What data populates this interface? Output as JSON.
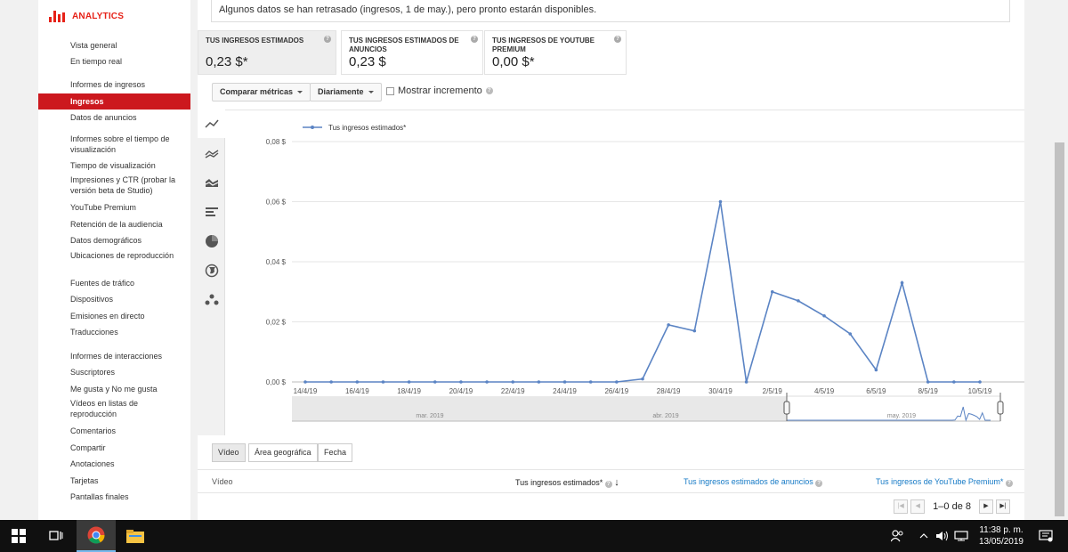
{
  "brand": {
    "label": "ANALYTICS",
    "color": "#e62117"
  },
  "sidebar": {
    "items": [
      {
        "label": "Vista general",
        "type": "link"
      },
      {
        "label": "En tiempo real",
        "type": "link"
      },
      {
        "label": "Informes de ingresos",
        "type": "section"
      },
      {
        "label": "Ingresos",
        "type": "link",
        "active": true
      },
      {
        "label": "Datos de anuncios",
        "type": "link"
      },
      {
        "label": "Informes sobre el tiempo de visualización",
        "type": "section"
      },
      {
        "label": "Tiempo de visualización",
        "type": "link"
      },
      {
        "label": "Impresiones y CTR (probar la versión beta de Studio)",
        "type": "link"
      },
      {
        "label": "YouTube Premium",
        "type": "link"
      },
      {
        "label": "Retención de la audiencia",
        "type": "link"
      },
      {
        "label": "Datos demográficos",
        "type": "link"
      },
      {
        "label": "Ubicaciones de reproducción",
        "type": "link"
      },
      {
        "label": "Fuentes de tráfico",
        "type": "link"
      },
      {
        "label": "Dispositivos",
        "type": "link"
      },
      {
        "label": "Emisiones en directo",
        "type": "link"
      },
      {
        "label": "Traducciones",
        "type": "link"
      },
      {
        "label": "Informes de interacciones",
        "type": "section"
      },
      {
        "label": "Suscriptores",
        "type": "link"
      },
      {
        "label": "Me gusta y No me gusta",
        "type": "link"
      },
      {
        "label": "Vídeos en listas de reproducción",
        "type": "link"
      },
      {
        "label": "Comentarios",
        "type": "link"
      },
      {
        "label": "Compartir",
        "type": "link"
      },
      {
        "label": "Anotaciones",
        "type": "link"
      },
      {
        "label": "Tarjetas",
        "type": "link"
      },
      {
        "label": "Pantallas finales",
        "type": "link"
      }
    ]
  },
  "notice": "Algunos datos se han retrasado (ingresos, 1 de may.), pero pronto estarán disponibles.",
  "kpis": [
    {
      "title": "TUS INGRESOS ESTIMADOS",
      "value": "0,23 $*",
      "selected": true
    },
    {
      "title": "TUS INGRESOS ESTIMADOS DE ANUNCIOS",
      "value": "0,23 $"
    },
    {
      "title": "TUS INGRESOS DE YOUTUBE PREMIUM",
      "value": "0,00 $*"
    }
  ],
  "controls": {
    "compare_label": "Comparar métricas",
    "period_label": "Diariamente",
    "increment_label": "Mostrar incremento"
  },
  "chart_tools": [
    "line-chart-icon",
    "multi-line-icon",
    "stacked-area-icon",
    "bar-chart-icon",
    "pie-chart-icon",
    "globe-icon",
    "bubble-chart-icon"
  ],
  "chart_data": {
    "type": "line",
    "legend": "Tus ingresos estimados*",
    "legend_position": "top-left",
    "grid": true,
    "x": [
      "14/4/19",
      "15/4/19",
      "16/4/19",
      "17/4/19",
      "18/4/19",
      "19/4/19",
      "20/4/19",
      "21/4/19",
      "22/4/19",
      "23/4/19",
      "24/4/19",
      "25/4/19",
      "26/4/19",
      "27/4/19",
      "28/4/19",
      "29/4/19",
      "30/4/19",
      "1/5/19",
      "2/5/19",
      "3/5/19",
      "4/5/19",
      "5/5/19",
      "6/5/19",
      "7/5/19",
      "8/5/19",
      "9/5/19",
      "10/5/19"
    ],
    "series": [
      {
        "name": "Tus ingresos estimados*",
        "color": "#5b84c4",
        "values": [
          0,
          0,
          0,
          0,
          0,
          0,
          0,
          0,
          0,
          0,
          0,
          0,
          0,
          0.001,
          0.019,
          0.017,
          0.06,
          0,
          0.03,
          0.027,
          0.022,
          0.016,
          0.004,
          0.033,
          0,
          0,
          0
        ]
      }
    ],
    "x_tick_labels": [
      "14/4/19",
      "16/4/19",
      "18/4/19",
      "20/4/19",
      "22/4/19",
      "24/4/19",
      "26/4/19",
      "28/4/19",
      "30/4/19",
      "2/5/19",
      "4/5/19",
      "6/5/19",
      "8/5/19",
      "10/5/19"
    ],
    "y_ticks": [
      "0,00 $",
      "0,02 $",
      "0,04 $",
      "0,06 $",
      "0,08 $"
    ],
    "y_values": [
      0,
      0.02,
      0.04,
      0.06,
      0.08
    ],
    "ylim": [
      0,
      0.08
    ],
    "navigator_labels": [
      "mar. 2019",
      "abr. 2019",
      "may. 2019"
    ]
  },
  "table": {
    "tabs": [
      {
        "label": "Vídeo",
        "active": true
      },
      {
        "label": "Área geográfica"
      },
      {
        "label": "Fecha"
      }
    ],
    "columns": {
      "video": "Vídeo",
      "est_revenue": "Tus ingresos estimados*",
      "ad_revenue": "Tus ingresos estimados de anuncios",
      "premium_revenue": "Tus ingresos de YouTube Premium*"
    },
    "pagination": "1–0 de 8"
  },
  "taskbar": {
    "time": "11:38 p. m.",
    "date": "13/05/2019"
  }
}
